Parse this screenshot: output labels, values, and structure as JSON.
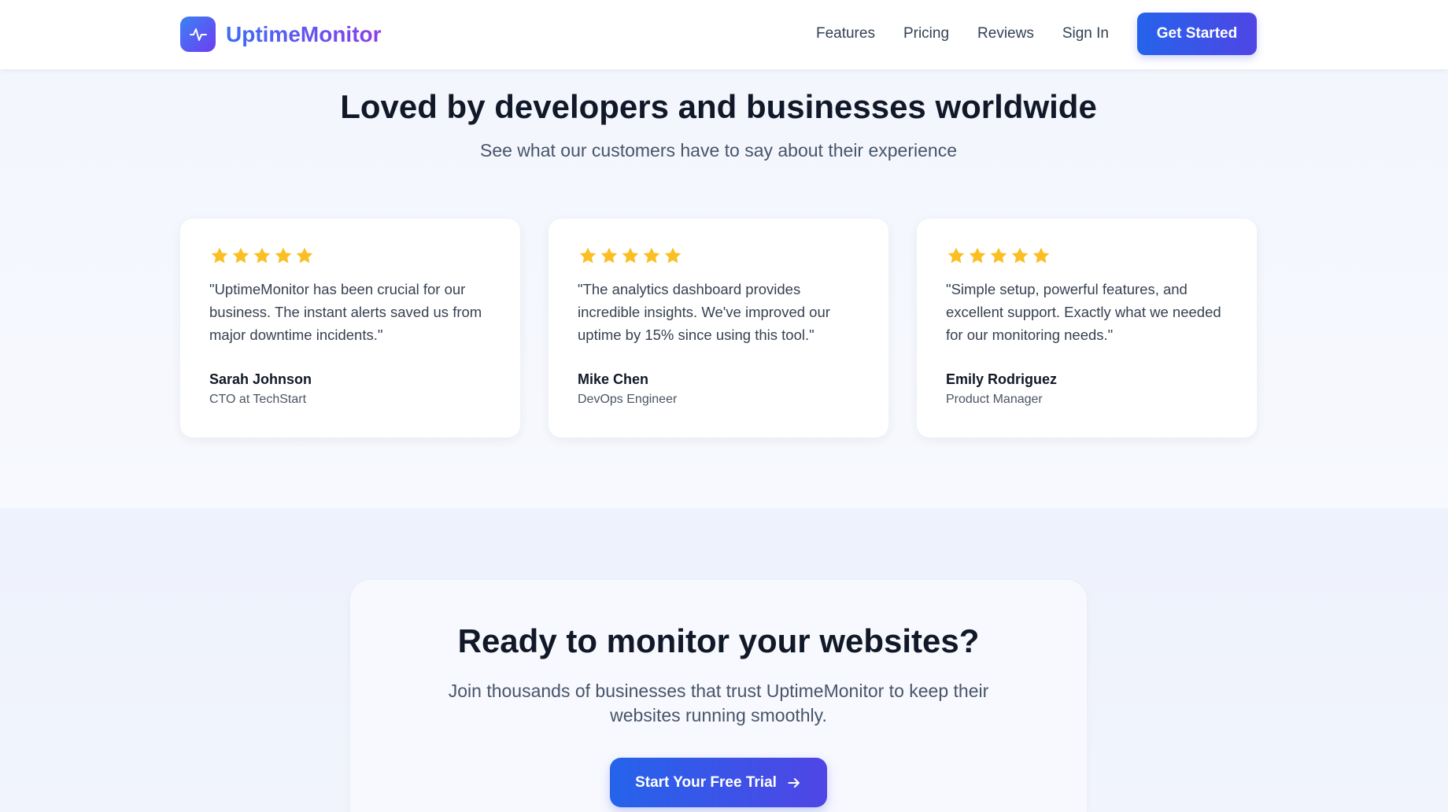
{
  "header": {
    "brand": "UptimeMonitor",
    "logo_icon": "activity-pulse-icon",
    "nav": [
      {
        "label": "Features"
      },
      {
        "label": "Pricing"
      },
      {
        "label": "Reviews"
      },
      {
        "label": "Sign In"
      }
    ],
    "cta_label": "Get Started"
  },
  "reviews": {
    "title": "Loved by developers and businesses worldwide",
    "subtitle": "See what our customers have to say about their experience",
    "star_icon": "star-icon",
    "star_color": "#fbbf24",
    "items": [
      {
        "rating": 5,
        "quote": "\"UptimeMonitor has been crucial for our business. The instant alerts saved us from major downtime incidents.\"",
        "name": "Sarah Johnson",
        "role": "CTO at TechStart"
      },
      {
        "rating": 5,
        "quote": "\"The analytics dashboard provides incredible insights. We've improved our uptime by 15% since using this tool.\"",
        "name": "Mike Chen",
        "role": "DevOps Engineer"
      },
      {
        "rating": 5,
        "quote": "\"Simple setup, powerful features, and excellent support. Exactly what we needed for our monitoring needs.\"",
        "name": "Emily Rodriguez",
        "role": "Product Manager"
      }
    ]
  },
  "cta": {
    "title": "Ready to monitor your websites?",
    "subtitle": "Join thousands of businesses that trust UptimeMonitor to keep their websites running smoothly.",
    "button_label": "Start Your Free Trial",
    "button_icon": "arrow-right-icon"
  },
  "colors": {
    "accent": "#2563eb",
    "accent_2": "#4f46e5",
    "brand_gradient_end": "#8b3fe8"
  }
}
